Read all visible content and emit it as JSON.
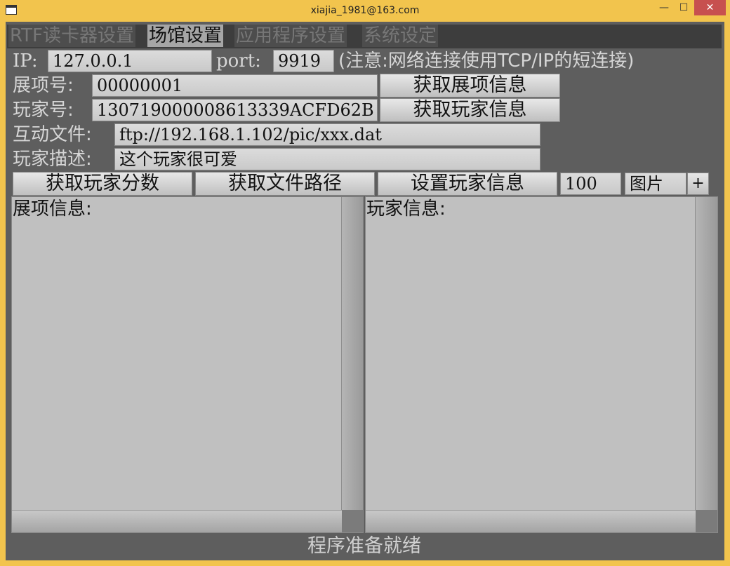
{
  "window": {
    "title": "xiajia_1981@163.com",
    "min_glyph": "—",
    "max_glyph": "☐",
    "close_glyph": "✕",
    "app_icon": "window-icon"
  },
  "tabs": [
    {
      "label": "RTF读卡器设置",
      "active": false
    },
    {
      "label": "场馆设置",
      "active": true
    },
    {
      "label": "应用程序设置",
      "active": false
    },
    {
      "label": "系统设定",
      "active": false
    }
  ],
  "conn": {
    "ip_label": "IP:",
    "ip_value": "127.0.0.1",
    "port_label": "port:",
    "port_value": "9919",
    "note": "(注意:网络连接使用TCP/IP的短连接)"
  },
  "exhibit": {
    "label": "展项号:",
    "value": "00000001",
    "button": "获取展项信息"
  },
  "player": {
    "label": "玩家号:",
    "value": "130719000008613339ACFD62B",
    "button": "获取玩家信息"
  },
  "file": {
    "label": "互动文件:",
    "value": "ftp://192.168.1.102/pic/xxx.dat"
  },
  "desc": {
    "label": "玩家描述:",
    "value": "这个玩家很可爱"
  },
  "actions": {
    "get_score": "获取玩家分数",
    "get_path": "获取文件路径",
    "set_player": "设置玩家信息",
    "score_value": "100",
    "type_value": "图片",
    "plus": "+"
  },
  "panels": {
    "exhibit_info_label": "展项信息:",
    "player_info_label": "玩家信息:"
  },
  "status": "程序准备就绪"
}
